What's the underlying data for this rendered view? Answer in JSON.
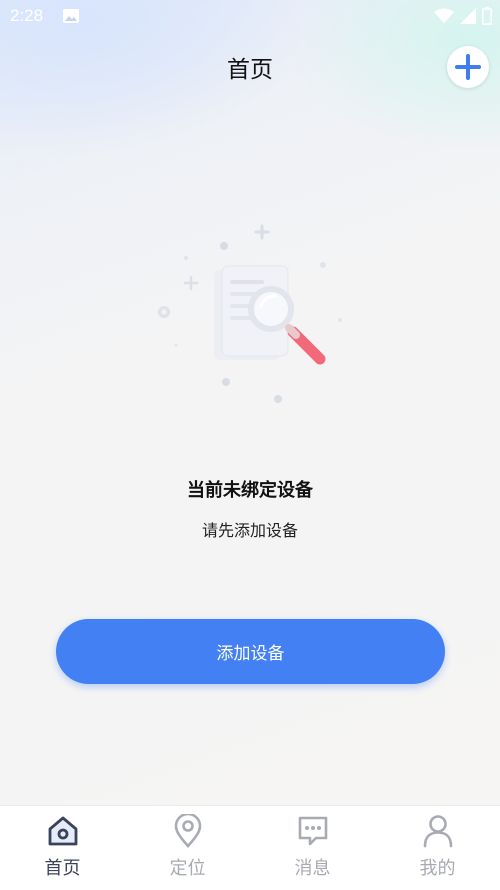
{
  "status_bar": {
    "time": "2:28"
  },
  "header": {
    "title": "首页"
  },
  "empty_state": {
    "title": "当前未绑定设备",
    "subtitle": "请先添加设备"
  },
  "actions": {
    "add_device_label": "添加设备"
  },
  "tabbar": {
    "items": [
      {
        "label": "首页",
        "icon": "home-icon",
        "active": true
      },
      {
        "label": "定位",
        "icon": "location-pin-icon",
        "active": false
      },
      {
        "label": "消息",
        "icon": "message-icon",
        "active": false
      },
      {
        "label": "我的",
        "icon": "person-icon",
        "active": false
      }
    ]
  },
  "colors": {
    "accent": "#4380f3",
    "tab_active": "#3a4358",
    "tab_inactive": "#a8abb1"
  }
}
